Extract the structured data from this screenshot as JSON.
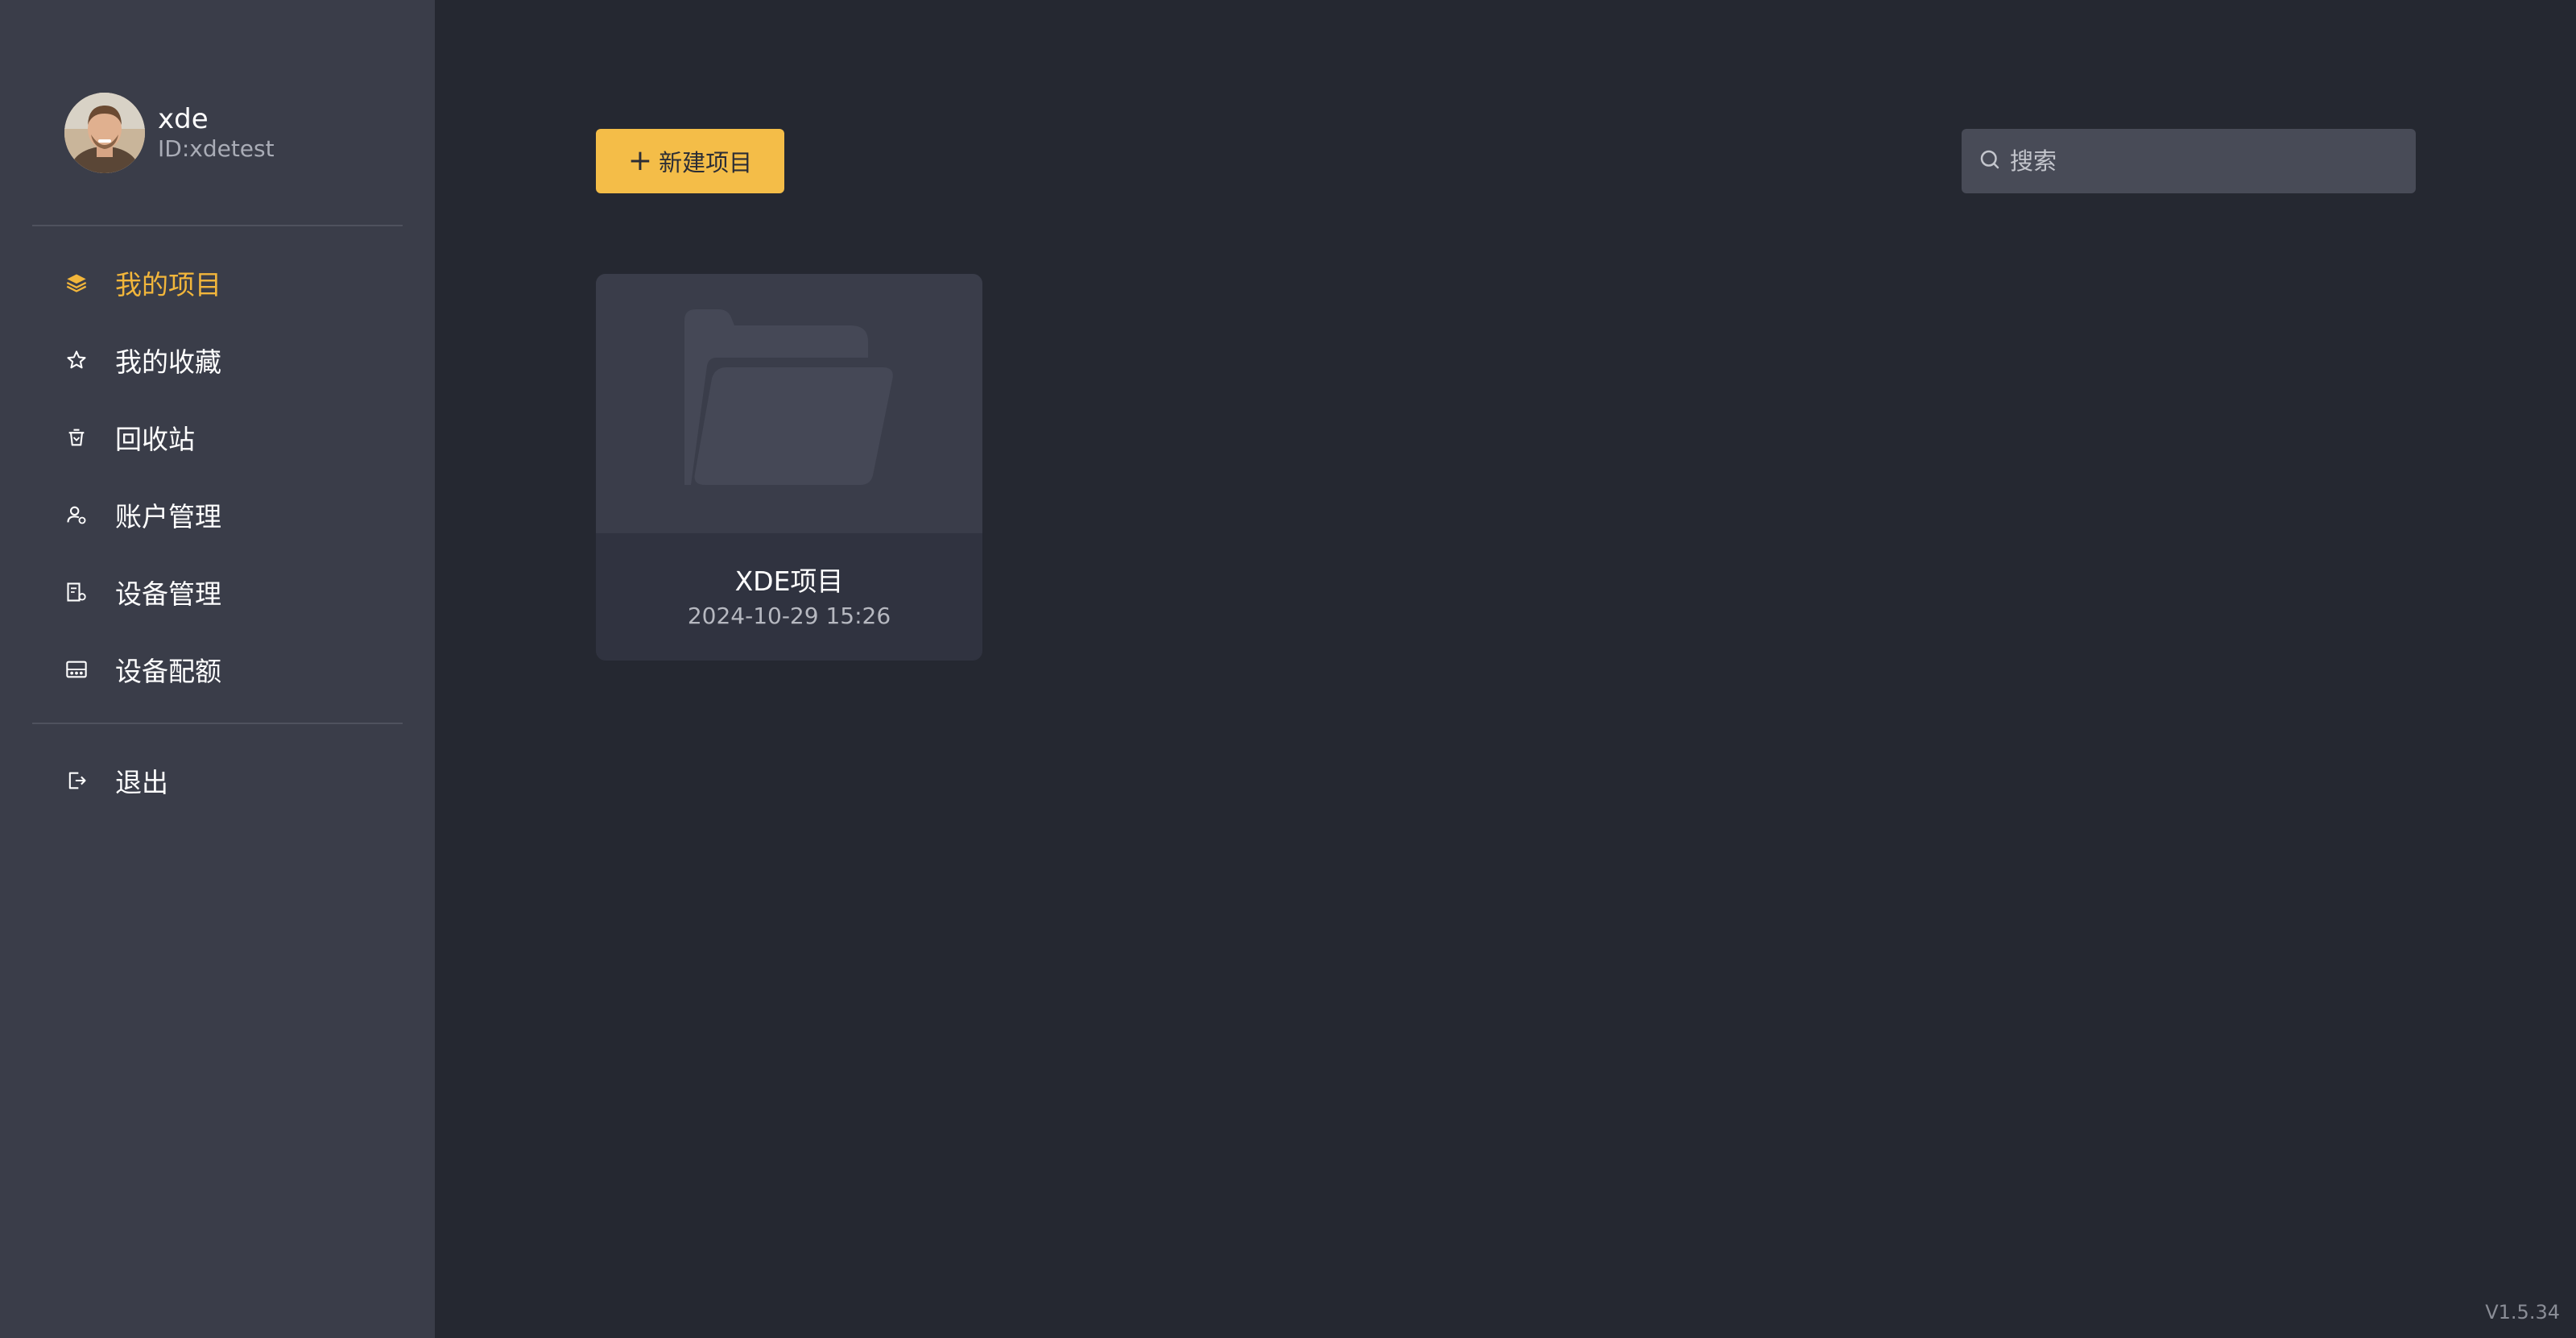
{
  "user": {
    "name": "xde",
    "id": "ID:xdetest"
  },
  "sidebar": {
    "items": [
      {
        "label": "我的项目",
        "icon": "layers-icon",
        "active": true
      },
      {
        "label": "我的收藏",
        "icon": "star-icon",
        "active": false
      },
      {
        "label": "回收站",
        "icon": "recycle-bin-icon",
        "active": false
      },
      {
        "label": "账户管理",
        "icon": "user-settings-icon",
        "active": false
      },
      {
        "label": "设备管理",
        "icon": "device-settings-icon",
        "active": false
      },
      {
        "label": "设备配额",
        "icon": "device-quota-icon",
        "active": false
      }
    ],
    "logout": {
      "label": "退出",
      "icon": "logout-icon"
    }
  },
  "toolbar": {
    "new_project_label": "新建项目",
    "new_project_icon": "plus-icon"
  },
  "search": {
    "placeholder": "搜索",
    "icon": "search-icon"
  },
  "projects": [
    {
      "title": "XDE项目",
      "date": "2024-10-29 15:26",
      "icon": "folder-icon"
    }
  ],
  "footer": {
    "version": "V1.5.34"
  },
  "colors": {
    "accent": "#f4bd48",
    "sidebar_bg": "#3a3d49",
    "main_bg": "#252831"
  }
}
